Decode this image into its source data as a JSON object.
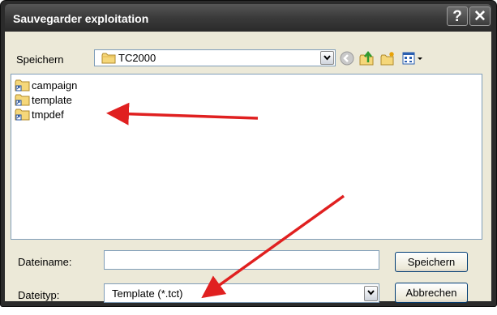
{
  "window": {
    "title": "Sauvegarder exploitation",
    "help_label": "?",
    "close_label": "✕"
  },
  "toolbar": {
    "save_in_label": "Speichern",
    "location_value": "TC2000",
    "icons": [
      "folder-icon",
      "back-icon",
      "up-folder-icon",
      "new-folder-icon",
      "view-menu-icon"
    ]
  },
  "files": [
    {
      "name": "campaign",
      "icon": "shortcut-folder-icon"
    },
    {
      "name": "template",
      "icon": "shortcut-folder-icon"
    },
    {
      "name": "tmpdef",
      "icon": "shortcut-folder-icon"
    }
  ],
  "form": {
    "filename_label": "Dateiname:",
    "filename_value": "",
    "filetype_label": "Dateityp:",
    "filetype_value": "Template (*.tct)",
    "save_button": "Speichern",
    "cancel_button": "Abbrechen"
  },
  "colors": {
    "annotation_arrow": "#e02020",
    "title_bar": "#3a3a3a",
    "dialog_bg": "#ece9d8"
  }
}
